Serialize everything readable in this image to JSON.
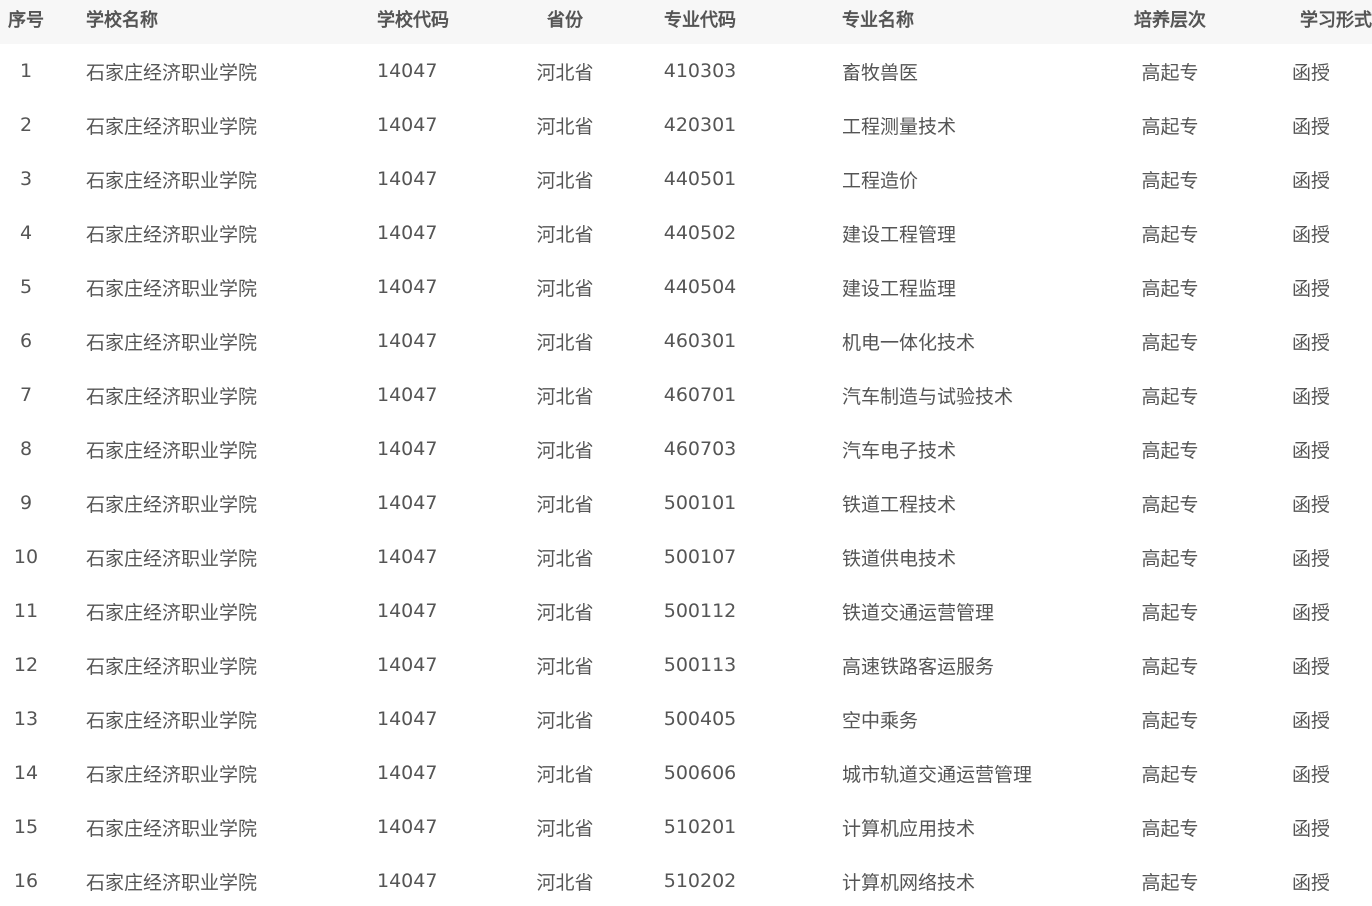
{
  "table": {
    "headers": [
      "序号",
      "学校名称",
      "学校代码",
      "省份",
      "专业代码",
      "专业名称",
      "培养层次",
      "学习形式"
    ],
    "rows": [
      [
        "1",
        "石家庄经济职业学院",
        "14047",
        "河北省",
        "410303",
        "畜牧兽医",
        "高起专",
        "函授"
      ],
      [
        "2",
        "石家庄经济职业学院",
        "14047",
        "河北省",
        "420301",
        "工程测量技术",
        "高起专",
        "函授"
      ],
      [
        "3",
        "石家庄经济职业学院",
        "14047",
        "河北省",
        "440501",
        "工程造价",
        "高起专",
        "函授"
      ],
      [
        "4",
        "石家庄经济职业学院",
        "14047",
        "河北省",
        "440502",
        "建设工程管理",
        "高起专",
        "函授"
      ],
      [
        "5",
        "石家庄经济职业学院",
        "14047",
        "河北省",
        "440504",
        "建设工程监理",
        "高起专",
        "函授"
      ],
      [
        "6",
        "石家庄经济职业学院",
        "14047",
        "河北省",
        "460301",
        "机电一体化技术",
        "高起专",
        "函授"
      ],
      [
        "7",
        "石家庄经济职业学院",
        "14047",
        "河北省",
        "460701",
        "汽车制造与试验技术",
        "高起专",
        "函授"
      ],
      [
        "8",
        "石家庄经济职业学院",
        "14047",
        "河北省",
        "460703",
        "汽车电子技术",
        "高起专",
        "函授"
      ],
      [
        "9",
        "石家庄经济职业学院",
        "14047",
        "河北省",
        "500101",
        "铁道工程技术",
        "高起专",
        "函授"
      ],
      [
        "10",
        "石家庄经济职业学院",
        "14047",
        "河北省",
        "500107",
        "铁道供电技术",
        "高起专",
        "函授"
      ],
      [
        "11",
        "石家庄经济职业学院",
        "14047",
        "河北省",
        "500112",
        "铁道交通运营管理",
        "高起专",
        "函授"
      ],
      [
        "12",
        "石家庄经济职业学院",
        "14047",
        "河北省",
        "500113",
        "高速铁路客运服务",
        "高起专",
        "函授"
      ],
      [
        "13",
        "石家庄经济职业学院",
        "14047",
        "河北省",
        "500405",
        "空中乘务",
        "高起专",
        "函授"
      ],
      [
        "14",
        "石家庄经济职业学院",
        "14047",
        "河北省",
        "500606",
        "城市轨道交通运营管理",
        "高起专",
        "函授"
      ],
      [
        "15",
        "石家庄经济职业学院",
        "14047",
        "河北省",
        "510201",
        "计算机应用技术",
        "高起专",
        "函授"
      ],
      [
        "16",
        "石家庄经济职业学院",
        "14047",
        "河北省",
        "510202",
        "计算机网络技术",
        "高起专",
        "函授"
      ]
    ]
  }
}
